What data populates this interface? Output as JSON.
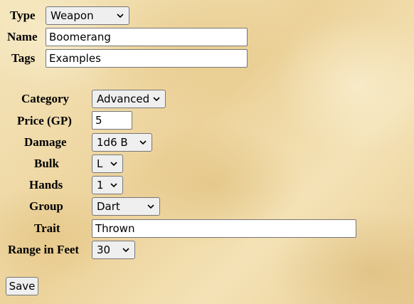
{
  "top": {
    "type_label": "Type",
    "type_value": "Weapon",
    "name_label": "Name",
    "name_value": "Boomerang",
    "tags_label": "Tags",
    "tags_value": "Examples"
  },
  "weapon": {
    "category_label": "Category",
    "category_value": "Advanced",
    "price_label": "Price (GP)",
    "price_value": "5",
    "damage_label": "Damage",
    "damage_value": "1d6 B",
    "bulk_label": "Bulk",
    "bulk_value": "L",
    "hands_label": "Hands",
    "hands_value": "1",
    "group_label": "Group",
    "group_value": "Dart",
    "trait_label": "Trait",
    "trait_value": "Thrown",
    "range_label": "Range in Feet",
    "range_value": "30"
  },
  "save_label": "Save",
  "icons": {
    "dropdown": "chevron-down-icon"
  }
}
